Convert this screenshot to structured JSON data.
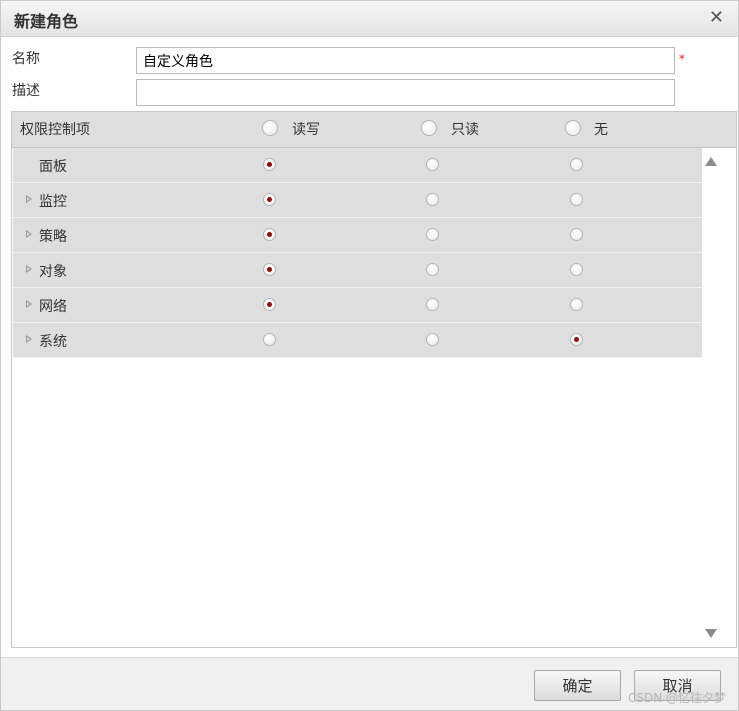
{
  "dialog": {
    "title": "新建角色"
  },
  "form": {
    "name_label": "名称",
    "name_value": "自定义角色",
    "required_mark": "*",
    "desc_label": "描述",
    "desc_value": ""
  },
  "grid": {
    "header_label": "权限控制项",
    "columns": [
      "读写",
      "只读",
      "无"
    ],
    "rows": [
      {
        "label": "面板",
        "expandable": false,
        "selected": "读写"
      },
      {
        "label": "监控",
        "expandable": true,
        "selected": "读写"
      },
      {
        "label": "策略",
        "expandable": true,
        "selected": "读写"
      },
      {
        "label": "对象",
        "expandable": true,
        "selected": "读写"
      },
      {
        "label": "网络",
        "expandable": true,
        "selected": "读写"
      },
      {
        "label": "系统",
        "expandable": true,
        "selected": "无"
      }
    ]
  },
  "footer": {
    "confirm_label": "确定",
    "cancel_label": "取消",
    "watermark": "CSDN @忆往夕梦"
  },
  "colors": {
    "accent": "#8b0f0f",
    "header_bg": "#dedede",
    "required": "#dd2222"
  }
}
